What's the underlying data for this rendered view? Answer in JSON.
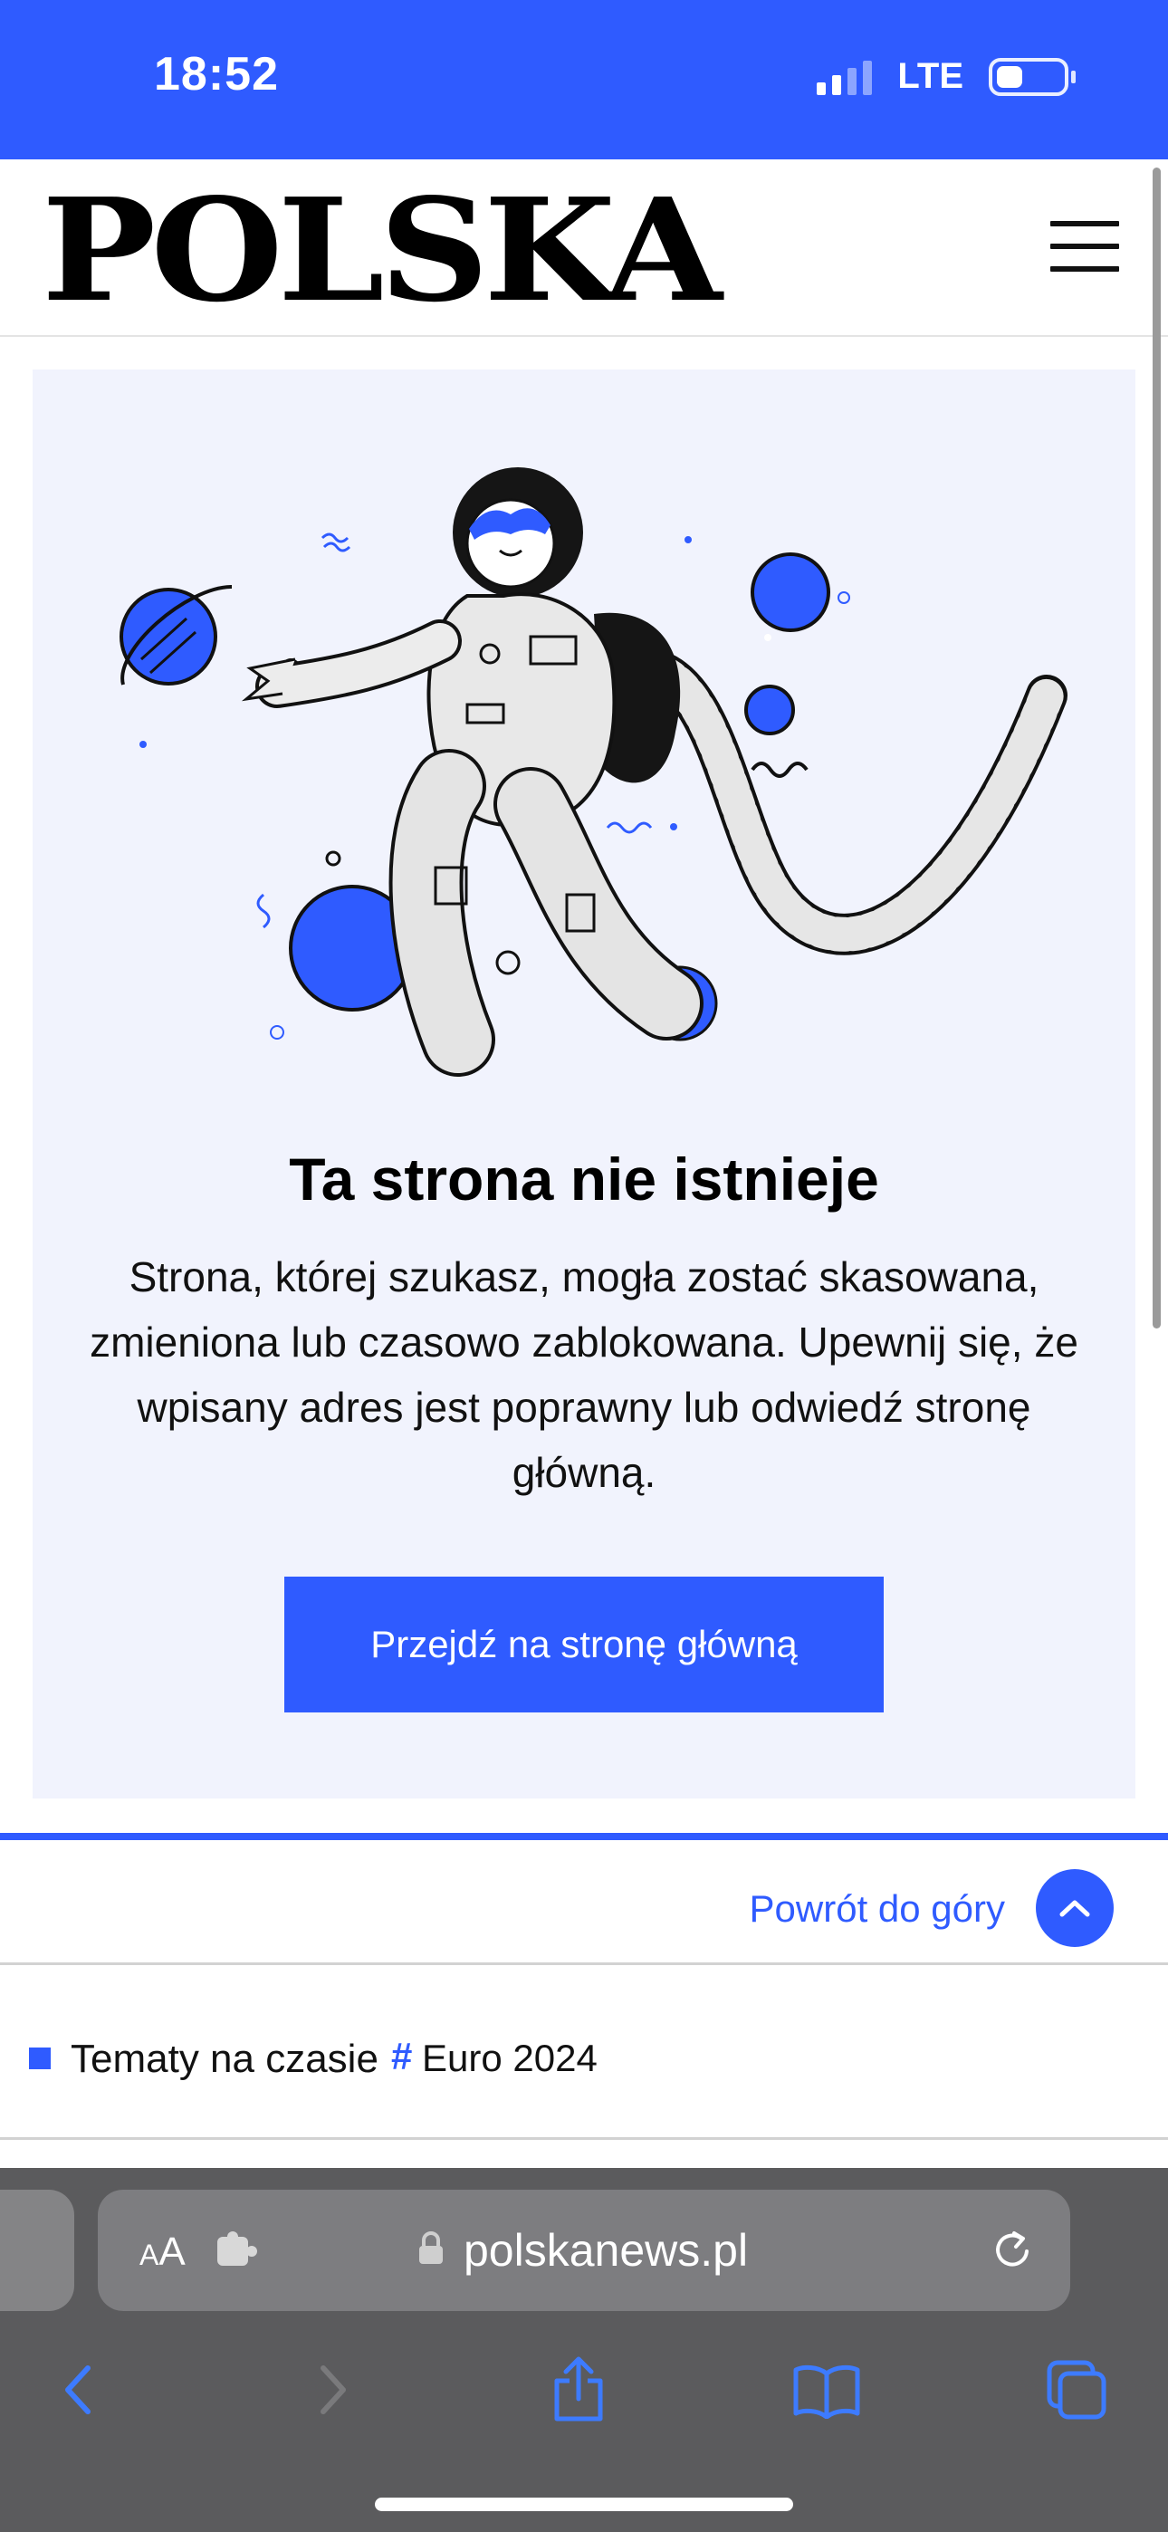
{
  "status_bar": {
    "time": "18:52",
    "network": "LTE",
    "signal_bars_filled": 2,
    "signal_bars_total": 4,
    "battery_level": 0.25
  },
  "header": {
    "logo_text": "POLSKA",
    "menu_icon": "hamburger-menu-icon"
  },
  "error": {
    "title": "Ta strona nie istnieje",
    "message": "Strona, której szukasz, mogła zostać skasowana, zmieniona lub czasowo zablokowana. Upewnij się, że wpisany adres jest poprawny lub odwiedź stronę główną.",
    "button_label": "Przejdź na stronę główną",
    "illustration": "astronaut-illustration"
  },
  "footer": {
    "back_to_top_label": "Powrót do góry",
    "topics_label": "Tematy na czasie",
    "topic_hash": "#",
    "topic_tag": "Euro 2024"
  },
  "browser": {
    "aa_label_small": "A",
    "aa_label_large": "A",
    "url": "polskanews.pl",
    "icons": [
      "chevron-left-icon",
      "chevron-right-icon",
      "share-icon",
      "bookmarks-icon",
      "tabs-icon",
      "reload-icon",
      "lock-icon",
      "extension-icon"
    ]
  },
  "colors": {
    "accent": "#2f5bff",
    "card_bg": "#f1f3fd",
    "safari_bar": "#5b5b5d",
    "address_bar": "#7d7d80"
  }
}
